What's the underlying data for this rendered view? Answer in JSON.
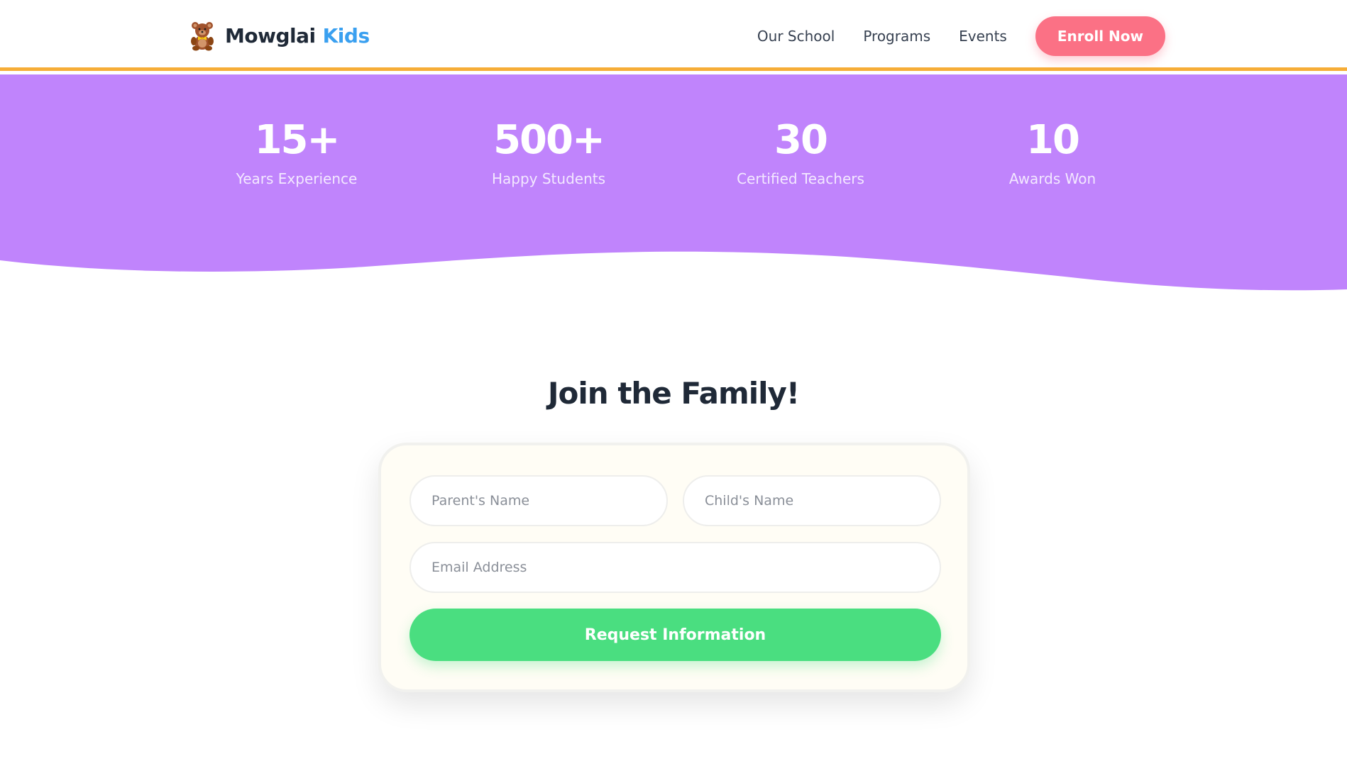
{
  "header": {
    "brand_name": "Mowglai",
    "brand_accent": "Kids",
    "brand_icon": "teddy-bear-icon",
    "nav": [
      {
        "label": "Our School"
      },
      {
        "label": "Programs"
      },
      {
        "label": "Events"
      }
    ],
    "cta_label": "Enroll Now"
  },
  "stats": [
    {
      "value": "15+",
      "label": "Years Experience"
    },
    {
      "value": "500+",
      "label": "Happy Students"
    },
    {
      "value": "30",
      "label": "Certified Teachers"
    },
    {
      "value": "10",
      "label": "Awards Won"
    }
  ],
  "join": {
    "title": "Join the Family!",
    "form": {
      "parent_placeholder": "Parent's Name",
      "child_placeholder": "Child's Name",
      "email_placeholder": "Email Address",
      "submit_label": "Request Information"
    }
  },
  "colors": {
    "brand_accent": "#3aa0f0",
    "header_border": "#f6ad37",
    "stats_band": "#c084fc",
    "cta": "#fb7185",
    "submit": "#4ade80",
    "text_dark": "#1f2937"
  }
}
